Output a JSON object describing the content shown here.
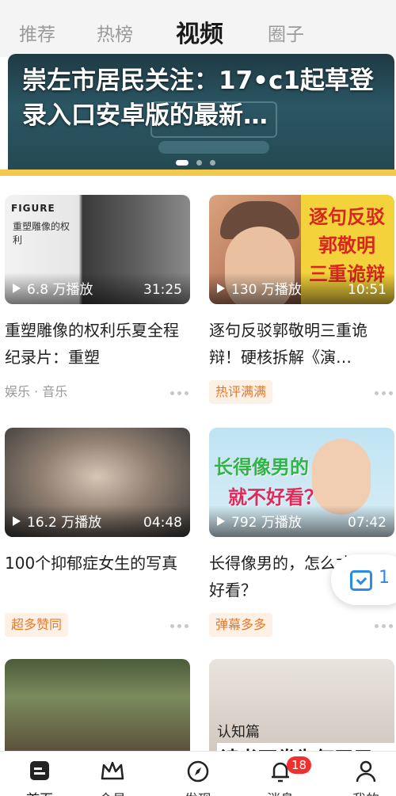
{
  "top_tabs": [
    "推荐",
    "热榜",
    "视频",
    "圈子"
  ],
  "active_tab_index": 2,
  "banner": {
    "title": "崇左市居民关注：17•c1起草登录入口安卓版的最新…",
    "dot_count": 3,
    "active_dot": 0
  },
  "videos": [
    {
      "plays": "6.8 万播放",
      "duration": "31:25",
      "title": "重塑雕像的权利乐夏全程纪录片：重塑",
      "category": "娱乐 · 音乐",
      "tag": "",
      "thumb_logo": "FIGURE",
      "thumb_text": "重塑雕像的权利"
    },
    {
      "plays": "130 万播放",
      "duration": "10:51",
      "title": "逐句反驳郭敬明三重诡辩！硬核拆解《演…",
      "category": "",
      "tag": "热评满满",
      "thumb_text": "逐句反驳 郭敬明 三重诡辩"
    },
    {
      "plays": "16.2 万播放",
      "duration": "04:48",
      "title": "100个抑郁症女生的写真",
      "category": "",
      "tag": "超多赞同"
    },
    {
      "plays": "792 万播放",
      "duration": "07:42",
      "title": "长得像男的，怎么才能最好看？",
      "category": "",
      "tag": "弹幕多多",
      "thumb_line1": "长得像男的",
      "thumb_line2": "就不好看？"
    },
    {
      "plays": "",
      "duration": "",
      "title": "",
      "category": "",
      "tag": ""
    },
    {
      "plays": "",
      "duration": "",
      "title": "",
      "category": "",
      "tag": "",
      "thumb_line1": "认知篇",
      "thumb_line2": "读书万卷为何无用"
    }
  ],
  "float_button": {
    "count": "1"
  },
  "bottom_nav": [
    {
      "label": "首页",
      "icon": "home-icon"
    },
    {
      "label": "会员",
      "icon": "crown-icon"
    },
    {
      "label": "发现",
      "icon": "compass-icon"
    },
    {
      "label": "消息",
      "icon": "bell-icon",
      "badge": "18"
    },
    {
      "label": "我的",
      "icon": "profile-icon"
    }
  ],
  "colors": {
    "accent": "#e8782b",
    "banner_bar": "#f2c94c",
    "badge": "#f0302e",
    "link_blue": "#2a8be8"
  }
}
